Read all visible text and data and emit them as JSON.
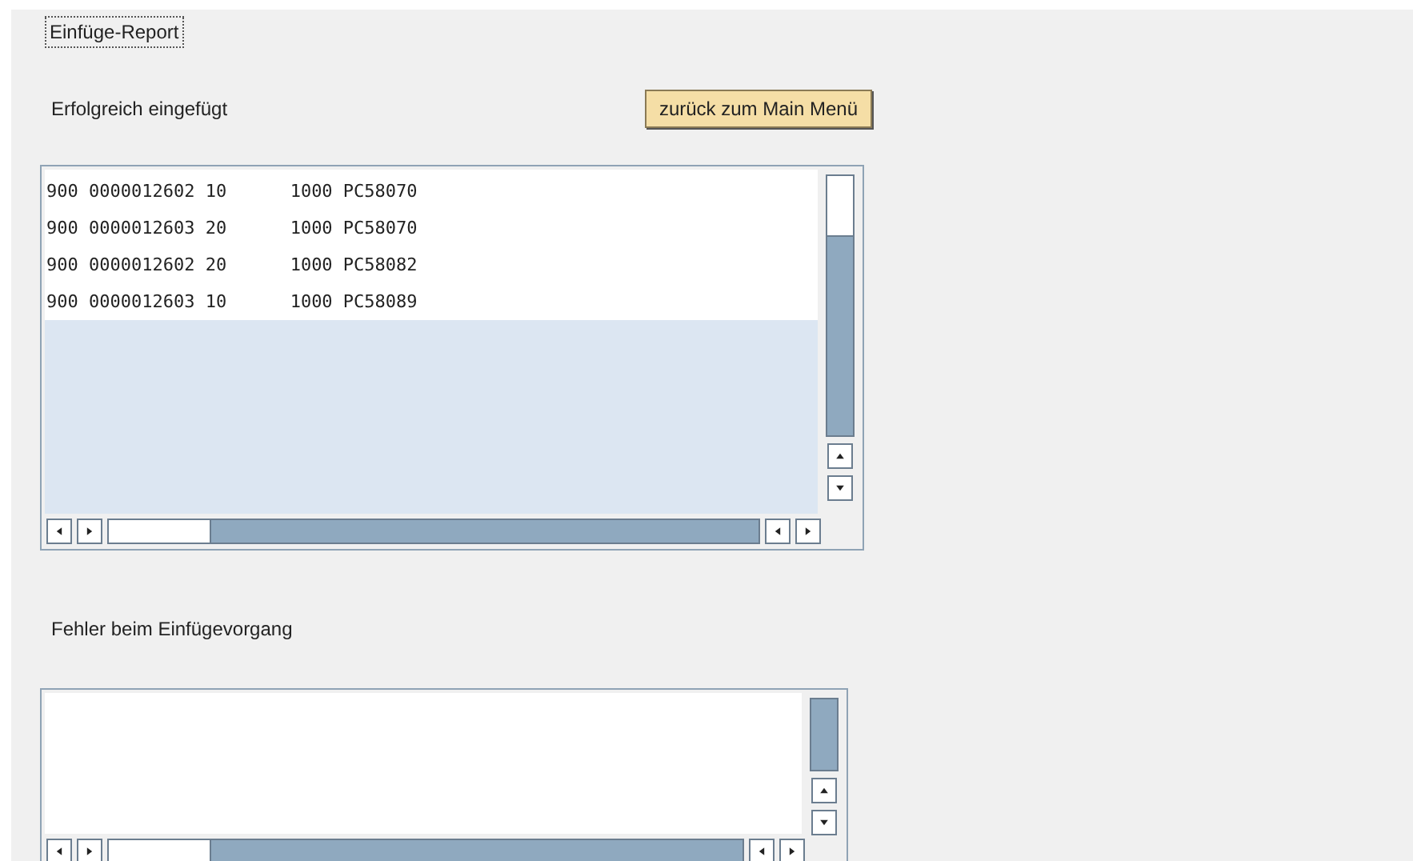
{
  "title": "Einfüge-Report",
  "success": {
    "label": "Erfolgreich eingefügt",
    "rows": [
      "900 0000012602 10      1000 PC58070",
      "900 0000012603 20      1000 PC58070",
      "900 0000012602 20      1000 PC58082",
      "900 0000012603 10      1000 PC58089"
    ]
  },
  "back_button": "zurück zum Main Menü",
  "errors": {
    "label": "Fehler beim Einfügevorgang"
  }
}
